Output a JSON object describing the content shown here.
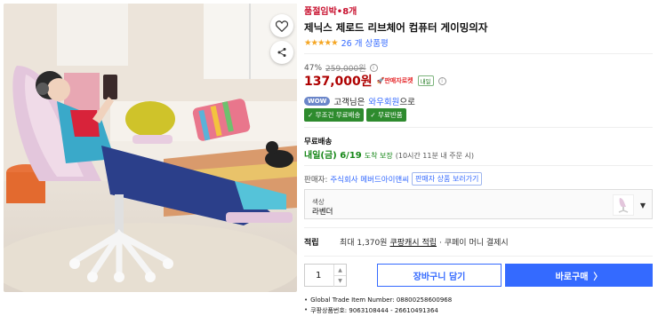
{
  "product": {
    "badge": "품절임박•8개",
    "title": "제닉스 제로드 리브체어 컴퓨터 게이밍의자",
    "rating_stars": "★★★★★",
    "review_count": "26 개 상품평"
  },
  "pricing": {
    "discount_percent": "47%",
    "original_price": "259,000원",
    "sale_price": "137,000원",
    "seller_rocket": "🚀판매자로켓",
    "mini_badge": "내일",
    "info_glyph": "i"
  },
  "wow": {
    "pill": "WOW",
    "text_prefix": "고객님은",
    "member_link": "와우회원",
    "text_suffix": "으로",
    "benefits": [
      "✓ 무조건 무료배송",
      "✓ 무료반품"
    ]
  },
  "shipping": {
    "title": "무료배송",
    "arrival_date": "내일(금) 6/19",
    "guarantee": "도착 보장",
    "note": "(10시간 11분 내 주문 시)"
  },
  "seller": {
    "label": "판매자:",
    "name": "주식회사 메버드아이앤씨",
    "other_products_button": "판매자 상품 보러가기"
  },
  "option": {
    "label": "색상",
    "value": "라벤더",
    "caret": "▼"
  },
  "points": {
    "label": "적립",
    "prefix": "최대 1,370원",
    "link": "쿠팡캐시 적립",
    "suffix": "· 쿠페이 머니 결제시"
  },
  "purchase": {
    "quantity": "1",
    "up_glyph": "▲",
    "down_glyph": "▼",
    "cart_button": "장바구니 담기",
    "buy_button": "바로구매",
    "buy_chevron": "〉"
  },
  "meta": {
    "gtin": "Global Trade Item Number: 08800258600968",
    "coupang_id": "쿠팡상품번호: 9063108444 - 26610491364",
    "bullet": "•"
  },
  "colors": {
    "accent_blue": "#346aff",
    "price_red": "#ae0000",
    "badge_red": "#c8102e",
    "green": "#168718",
    "star": "#f5a623"
  }
}
